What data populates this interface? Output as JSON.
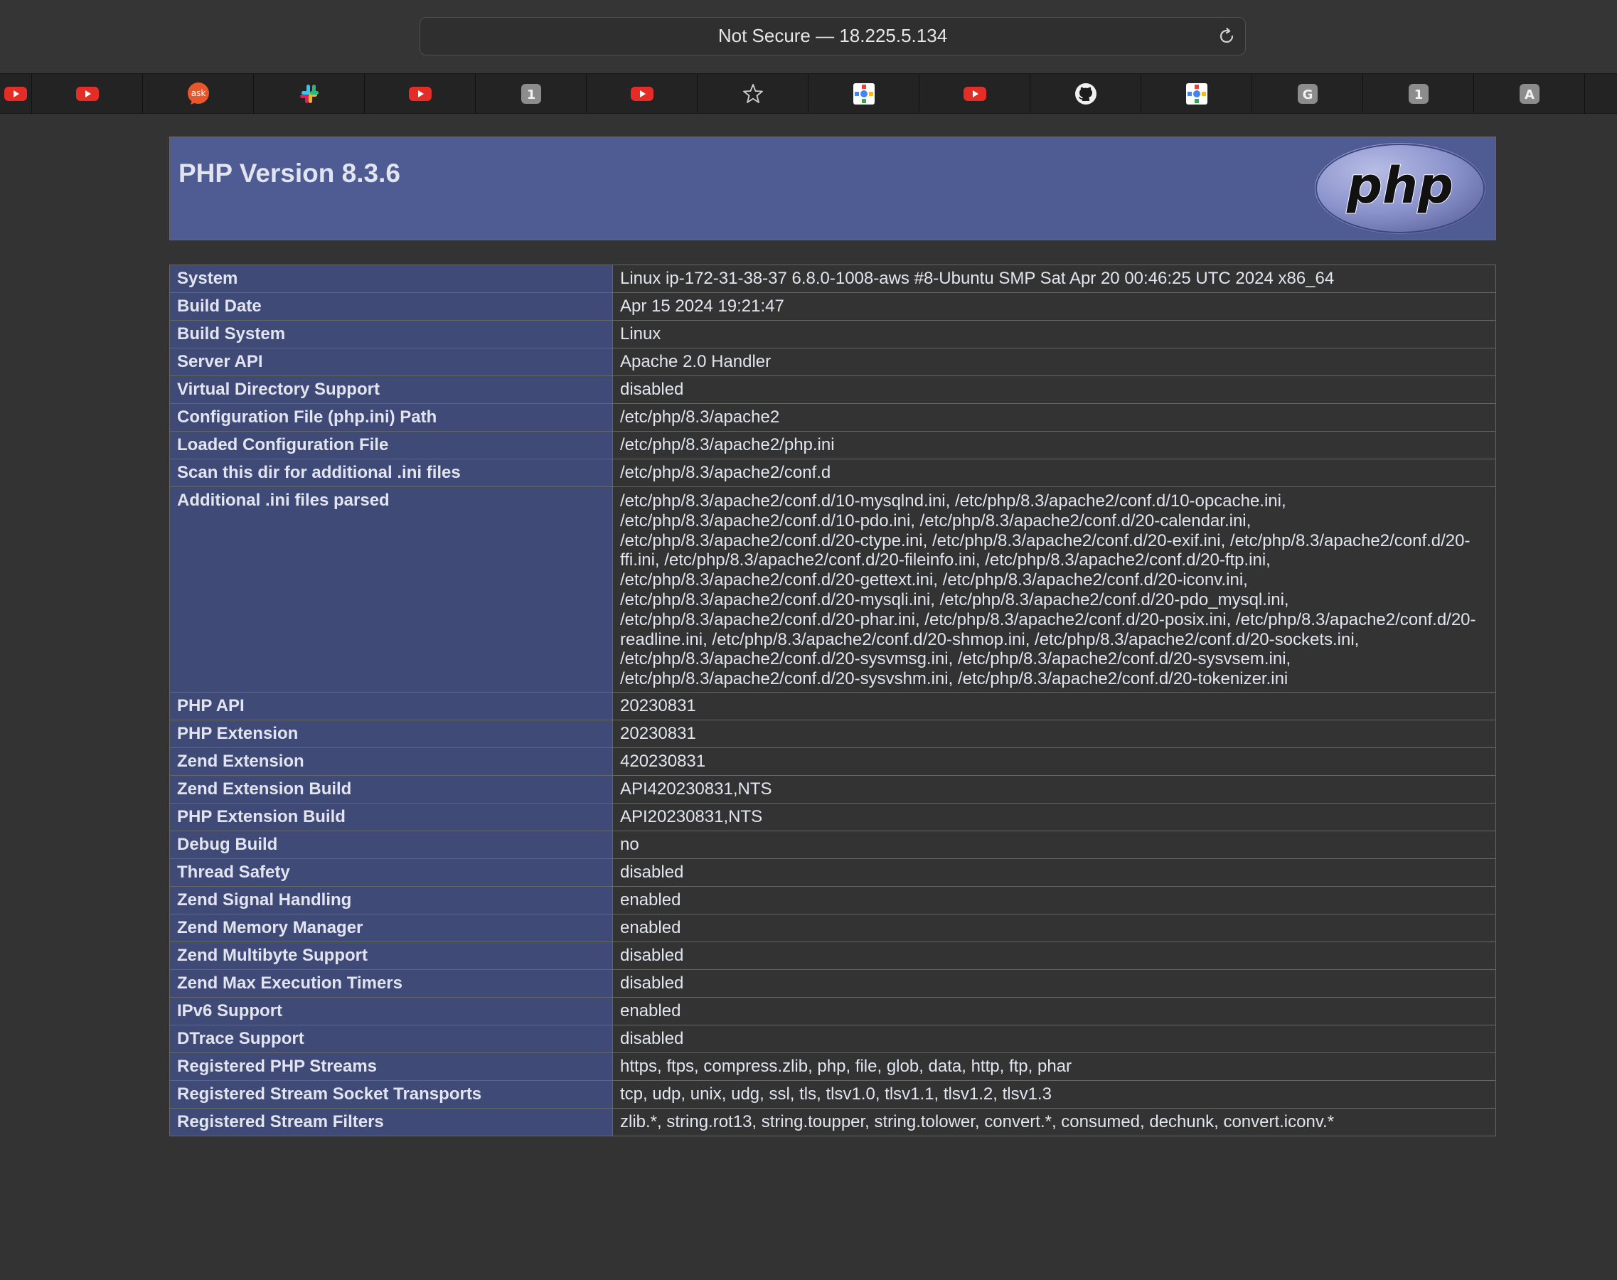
{
  "browser": {
    "address": "Not Secure — 18.225.5.134",
    "favorites": [
      {
        "icon": "youtube-icon",
        "width": 44
      },
      {
        "icon": "youtube-icon",
        "width": 156
      },
      {
        "icon": "ask-icon",
        "label": "ask",
        "width": 156
      },
      {
        "icon": "slack-icon",
        "width": 156
      },
      {
        "icon": "youtube-icon",
        "width": 156
      },
      {
        "icon": "letter-tile-icon",
        "label": "1",
        "width": 156
      },
      {
        "icon": "youtube-icon",
        "width": 156
      },
      {
        "icon": "star-icon",
        "width": 156
      },
      {
        "icon": "google-cloud-icon",
        "width": 156
      },
      {
        "icon": "youtube-icon",
        "width": 156
      },
      {
        "icon": "github-icon",
        "width": 156
      },
      {
        "icon": "google-cloud-icon",
        "width": 156
      },
      {
        "icon": "letter-tile-icon",
        "label": "G",
        "width": 156
      },
      {
        "icon": "letter-tile-icon",
        "label": "1",
        "width": 156
      },
      {
        "icon": "letter-tile-icon",
        "label": "A",
        "width": 156
      },
      {
        "icon": "empty",
        "width": 58
      }
    ]
  },
  "php": {
    "title": "PHP Version 8.3.6",
    "logo_text": "php"
  },
  "rows": [
    {
      "key": "System",
      "value": "Linux ip-172-31-38-37 6.8.0-1008-aws #8-Ubuntu SMP Sat Apr 20 00:46:25 UTC 2024 x86_64"
    },
    {
      "key": "Build Date",
      "value": "Apr 15 2024 19:21:47"
    },
    {
      "key": "Build System",
      "value": "Linux"
    },
    {
      "key": "Server API",
      "value": "Apache 2.0 Handler"
    },
    {
      "key": "Virtual Directory Support",
      "value": "disabled"
    },
    {
      "key": "Configuration File (php.ini) Path",
      "value": "/etc/php/8.3/apache2"
    },
    {
      "key": "Loaded Configuration File",
      "value": "/etc/php/8.3/apache2/php.ini"
    },
    {
      "key": "Scan this dir for additional .ini files",
      "value": "/etc/php/8.3/apache2/conf.d"
    },
    {
      "key": "Additional .ini files parsed",
      "value": "/etc/php/8.3/apache2/conf.d/10-mysqlnd.ini, /etc/php/8.3/apache2/conf.d/10-opcache.ini,\n/etc/php/8.3/apache2/conf.d/10-pdo.ini, /etc/php/8.3/apache2/conf.d/20-calendar.ini,\n/etc/php/8.3/apache2/conf.d/20-ctype.ini, /etc/php/8.3/apache2/conf.d/20-exif.ini, /etc/php/8.3/apache2/conf.d/20-\nffi.ini, /etc/php/8.3/apache2/conf.d/20-fileinfo.ini, /etc/php/8.3/apache2/conf.d/20-ftp.ini,\n/etc/php/8.3/apache2/conf.d/20-gettext.ini, /etc/php/8.3/apache2/conf.d/20-iconv.ini,\n/etc/php/8.3/apache2/conf.d/20-mysqli.ini, /etc/php/8.3/apache2/conf.d/20-pdo_mysql.ini,\n/etc/php/8.3/apache2/conf.d/20-phar.ini, /etc/php/8.3/apache2/conf.d/20-posix.ini, /etc/php/8.3/apache2/conf.d/20-\nreadline.ini, /etc/php/8.3/apache2/conf.d/20-shmop.ini, /etc/php/8.3/apache2/conf.d/20-sockets.ini,\n/etc/php/8.3/apache2/conf.d/20-sysvmsg.ini, /etc/php/8.3/apache2/conf.d/20-sysvsem.ini,\n/etc/php/8.3/apache2/conf.d/20-sysvshm.ini, /etc/php/8.3/apache2/conf.d/20-tokenizer.ini",
      "multiline": true
    },
    {
      "key": "PHP API",
      "value": "20230831"
    },
    {
      "key": "PHP Extension",
      "value": "20230831"
    },
    {
      "key": "Zend Extension",
      "value": "420230831"
    },
    {
      "key": "Zend Extension Build",
      "value": "API420230831,NTS"
    },
    {
      "key": "PHP Extension Build",
      "value": "API20230831,NTS"
    },
    {
      "key": "Debug Build",
      "value": "no"
    },
    {
      "key": "Thread Safety",
      "value": "disabled"
    },
    {
      "key": "Zend Signal Handling",
      "value": "enabled"
    },
    {
      "key": "Zend Memory Manager",
      "value": "enabled"
    },
    {
      "key": "Zend Multibyte Support",
      "value": "disabled"
    },
    {
      "key": "Zend Max Execution Timers",
      "value": "disabled"
    },
    {
      "key": "IPv6 Support",
      "value": "enabled"
    },
    {
      "key": "DTrace Support",
      "value": "disabled"
    },
    {
      "key": "Registered PHP Streams",
      "value": "https, ftps, compress.zlib, php, file, glob, data, http, ftp, phar"
    },
    {
      "key": "Registered Stream Socket Transports",
      "value": "tcp, udp, unix, udg, ssl, tls, tlsv1.0, tlsv1.1, tlsv1.2, tlsv1.3"
    },
    {
      "key": "Registered Stream Filters",
      "value": "zlib.*, string.rot13, string.toupper, string.tolower, convert.*, consumed, dechunk, convert.iconv.*"
    }
  ]
}
